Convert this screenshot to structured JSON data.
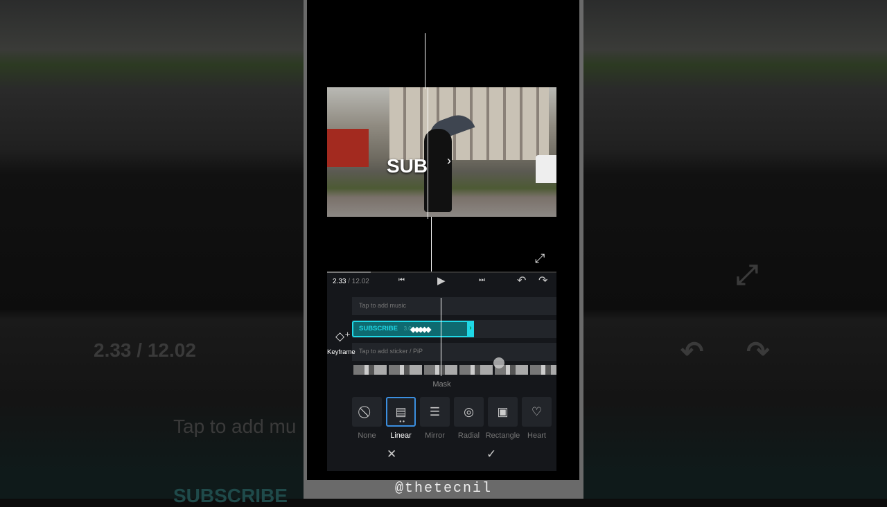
{
  "watermark": "@thetecnil",
  "preview": {
    "overlay_text": "SUB"
  },
  "player": {
    "current_time": "2.33",
    "total_time": " / 12.02",
    "prev_icon": "⏮",
    "play_icon": "▶",
    "next_icon": "⏭",
    "undo_icon": "↶",
    "redo_icon": "↷",
    "progress_fraction": 0.19
  },
  "timeline": {
    "music_placeholder": "Tap to add music",
    "text_clip_label": "SUBSCRIBE",
    "text_clip_duration": "3.0",
    "sticker_placeholder": "Tap to add sticker / PiP",
    "keyframe_label": "Keyframe"
  },
  "mask": {
    "title": "Mask",
    "options": [
      {
        "label": "None",
        "icon": "⃠"
      },
      {
        "label": "Linear",
        "icon": "▤"
      },
      {
        "label": "Mirror",
        "icon": "☰"
      },
      {
        "label": "Radial",
        "icon": "◎"
      },
      {
        "label": "Rectangle",
        "icon": "▣"
      },
      {
        "label": "Heart",
        "icon": "♡"
      }
    ],
    "selected": "Linear",
    "cancel_icon": "✕",
    "confirm_icon": "✓"
  },
  "background": {
    "ghost_time": "2.33 / 12.02",
    "ghost_music": "Tap to add mu",
    "ghost_sub": "SUBSCRIBE"
  },
  "colors": {
    "accent": "#1fd8e6",
    "selected": "#3b8fe0",
    "panel": "#15171b"
  }
}
